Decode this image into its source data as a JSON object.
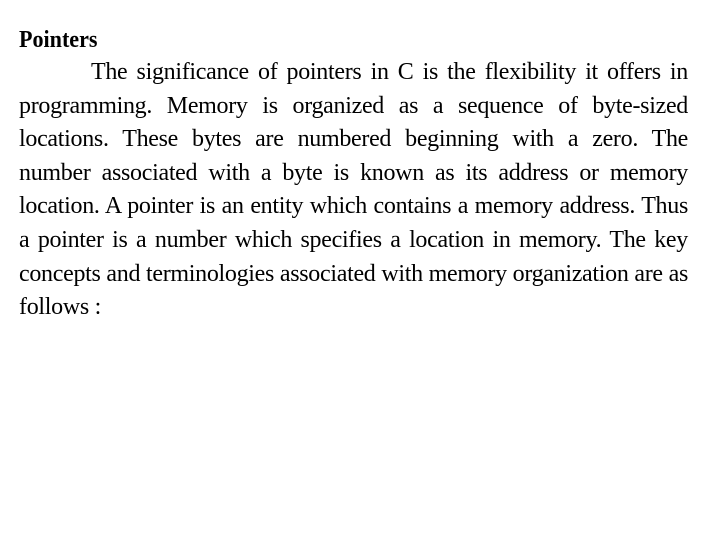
{
  "document": {
    "heading": "Pointers",
    "paragraph": "The significance of pointers in C is the flexibility it offers in programming. Memory is organized as a sequence of byte-sized locations. These bytes are numbered beginning with a zero. The number associated with a byte is known as its address or memory location. A pointer is an entity which contains a memory address. Thus a pointer is a number which specifies a location in memory. The key concepts and terminologies associated with memory organization are as follows :"
  }
}
